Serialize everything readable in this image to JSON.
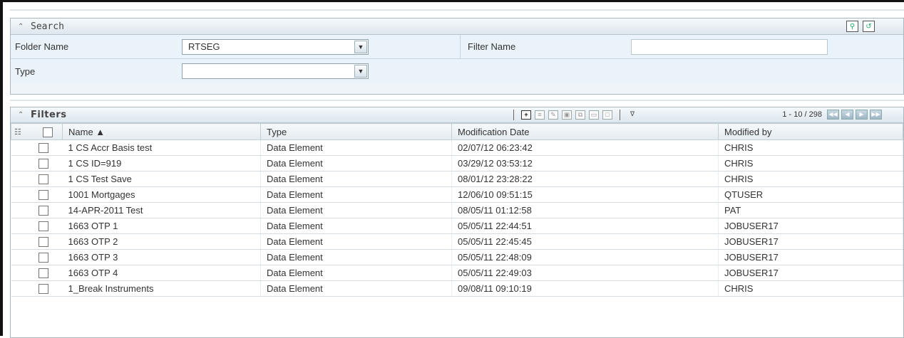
{
  "search": {
    "title": "Search",
    "collapse_glyph": "⌃",
    "tools": [
      {
        "name": "search-execute-icon",
        "glyph": "🔍"
      },
      {
        "name": "reset-icon",
        "glyph": "↺"
      }
    ],
    "folder_label": "Folder Name",
    "folder_value": "RTSEG",
    "filter_label": "Filter Name",
    "filter_value": "",
    "type_label": "Type",
    "type_value": ""
  },
  "filters": {
    "title": "Filters",
    "pager_text": "1 - 10 / 298",
    "columns": [
      "Name ▲",
      "Type",
      "Modification Date",
      "Modified by"
    ],
    "rows": [
      {
        "name": "1 CS Accr Basis test",
        "type": "Data Element",
        "date": "02/07/12 06:23:42",
        "by": "CHRIS"
      },
      {
        "name": "1 CS ID=919",
        "type": "Data Element",
        "date": "03/29/12 03:53:12",
        "by": "CHRIS"
      },
      {
        "name": "1 CS Test Save",
        "type": "Data Element",
        "date": "08/01/12 23:28:22",
        "by": "CHRIS"
      },
      {
        "name": "1001 Mortgages",
        "type": "Data Element",
        "date": "12/06/10 09:51:15",
        "by": "QTUSER"
      },
      {
        "name": "14-APR-2011 Test",
        "type": "Data Element",
        "date": "08/05/11 01:12:58",
        "by": "PAT"
      },
      {
        "name": "1663 OTP 1",
        "type": "Data Element",
        "date": "05/05/11 22:44:51",
        "by": "JOBUSER17"
      },
      {
        "name": "1663 OTP 2",
        "type": "Data Element",
        "date": "05/05/11 22:45:45",
        "by": "JOBUSER17"
      },
      {
        "name": "1663 OTP 3",
        "type": "Data Element",
        "date": "05/05/11 22:48:09",
        "by": "JOBUSER17"
      },
      {
        "name": "1663 OTP 4",
        "type": "Data Element",
        "date": "05/05/11 22:49:03",
        "by": "JOBUSER17"
      },
      {
        "name": "1_Break Instruments",
        "type": "Data Element",
        "date": "09/08/11 09:10:19",
        "by": "CHRIS"
      }
    ]
  }
}
